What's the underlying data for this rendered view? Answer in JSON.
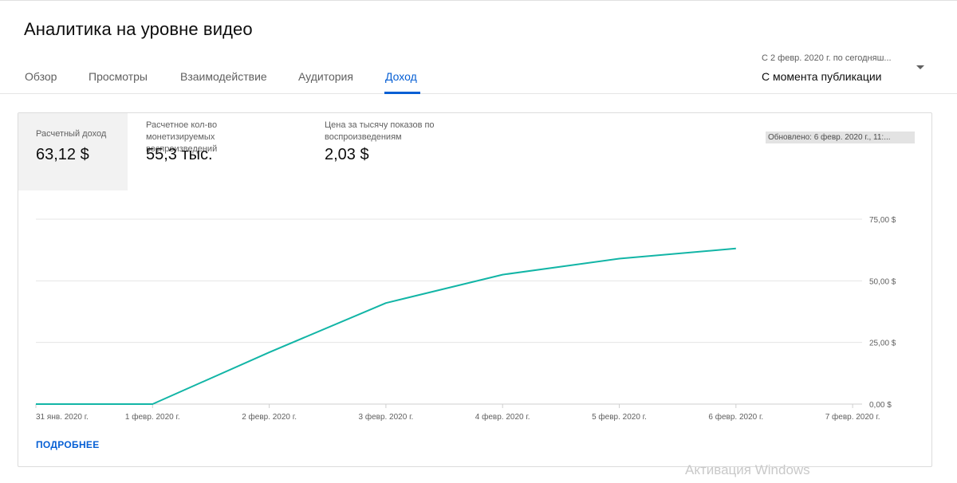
{
  "page": {
    "title": "Аналитика на уровне видео"
  },
  "tabs": [
    {
      "label": "Обзор"
    },
    {
      "label": "Просмотры"
    },
    {
      "label": "Взаимодействие"
    },
    {
      "label": "Аудитория"
    },
    {
      "label": "Доход",
      "active": true
    }
  ],
  "date_picker": {
    "range": "С 2 февр. 2020 г. по сегодняш...",
    "period": "С момента публикации",
    "icon": "chevron-down-icon"
  },
  "metrics": [
    {
      "label": "Расчетный доход",
      "value": "63,12 $",
      "selected": true
    },
    {
      "label_lines": [
        "Расчетное кол-во",
        "монетизируемых",
        "воспроизведений"
      ],
      "value": "55,3 тыс."
    },
    {
      "label_lines": [
        "Цена за тысячу показов по",
        "воспроизведениям"
      ],
      "value": "2,03 $"
    }
  ],
  "updated": "Обновлено: 6 февр. 2020 г., 11:...",
  "more_link": "ПОДРОБНЕЕ",
  "watermark": "Активация Windows",
  "colors": {
    "accent": "#065fd4",
    "line": "#12b5a6",
    "grid": "#e5e5e5"
  },
  "chart_data": {
    "type": "line",
    "x": [
      "31 янв. 2020 г.",
      "1 февр. 2020 г.",
      "2 февр. 2020 г.",
      "3 февр. 2020 г.",
      "4 февр. 2020 г.",
      "5 февр. 2020 г.",
      "6 февр. 2020 г.",
      "7 февр. 2020 г."
    ],
    "series": [
      {
        "values": [
          0,
          0,
          21,
          41,
          52.5,
          59,
          63.12,
          null
        ]
      }
    ],
    "y_ticks": [
      "0,00 $",
      "25,00 $",
      "50,00 $",
      "75,00 $"
    ],
    "ylim": [
      0,
      75
    ],
    "y_axis_side": "right",
    "grid": true
  }
}
